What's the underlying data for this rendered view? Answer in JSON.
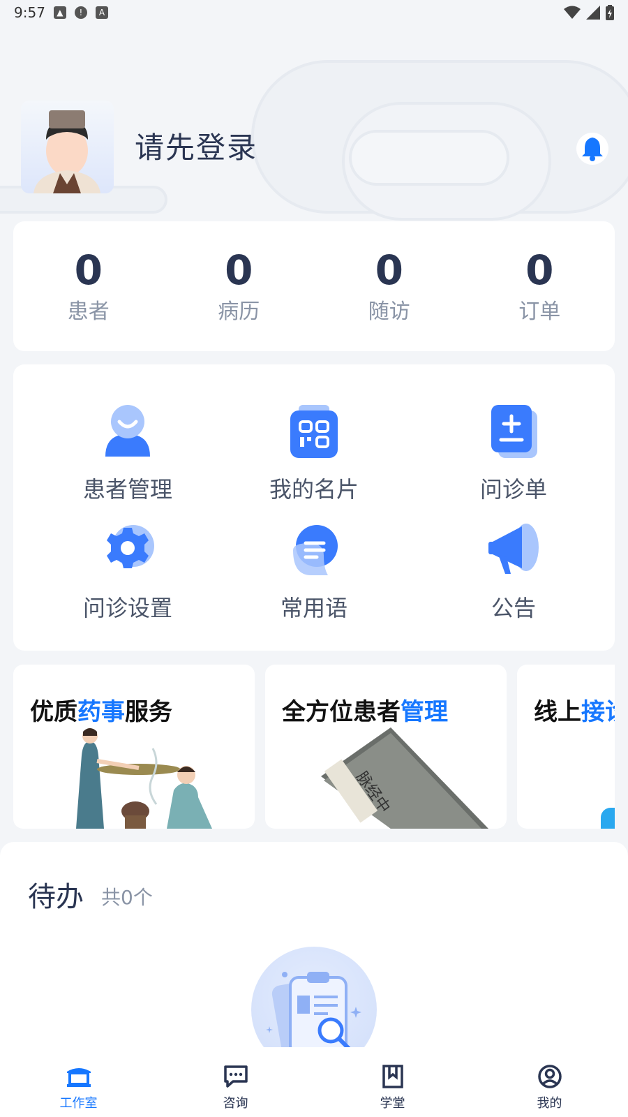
{
  "status_bar": {
    "time": "9:57"
  },
  "profile": {
    "login_prompt": "请先登录"
  },
  "stats": [
    {
      "value": "0",
      "label": "患者"
    },
    {
      "value": "0",
      "label": "病历"
    },
    {
      "value": "0",
      "label": "随访"
    },
    {
      "value": "0",
      "label": "订单"
    }
  ],
  "grid": [
    {
      "label": "患者管理",
      "icon": "patient-icon"
    },
    {
      "label": "我的名片",
      "icon": "qr-card-icon"
    },
    {
      "label": "问诊单",
      "icon": "consult-form-icon"
    },
    {
      "label": "问诊设置",
      "icon": "settings-gear-icon"
    },
    {
      "label": "常用语",
      "icon": "chat-bubble-icon"
    },
    {
      "label": "公告",
      "icon": "megaphone-icon"
    }
  ],
  "banners": [
    {
      "title_plain": "优质",
      "title_hl": "药事",
      "title_rest": "服务"
    },
    {
      "title_plain": "全方位患者",
      "title_hl": "管理",
      "title_rest": ""
    },
    {
      "title_plain": "线上",
      "title_hl": "接诊",
      "title_rest": ""
    }
  ],
  "book_text": "脉经中",
  "todo": {
    "title": "待办",
    "count_text": "共0个"
  },
  "nav": [
    {
      "label": "工作室",
      "icon": "studio-icon",
      "active": true
    },
    {
      "label": "咨询",
      "icon": "chat-icon",
      "active": false
    },
    {
      "label": "学堂",
      "icon": "bookmark-icon",
      "active": false
    },
    {
      "label": "我的",
      "icon": "user-circle-icon",
      "active": false
    }
  ],
  "colors": {
    "accent": "#1677ff",
    "text_primary": "#2a3552",
    "text_secondary": "#8a94a6",
    "icon_blue": "#3a7bfd"
  }
}
